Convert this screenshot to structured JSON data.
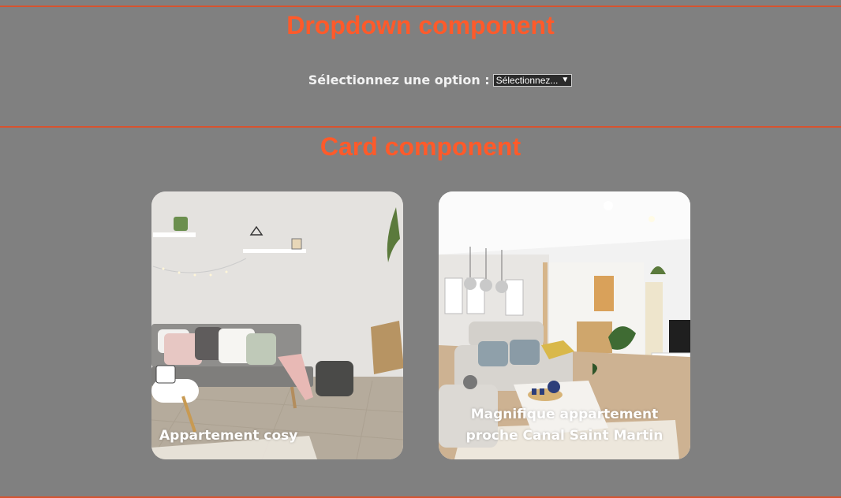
{
  "dropdown_section": {
    "title": "Dropdown component",
    "label": "Sélectionnez une option :",
    "select_value": "Sélectionnez..."
  },
  "card_section": {
    "title": "Card component",
    "cards": [
      {
        "title": "Appartement cosy"
      },
      {
        "title": "Magnifique appartement proche Canal Saint Martin"
      }
    ]
  },
  "colors": {
    "background": "#808080",
    "accent": "#ff5a2a",
    "rule": "#d7532f"
  }
}
